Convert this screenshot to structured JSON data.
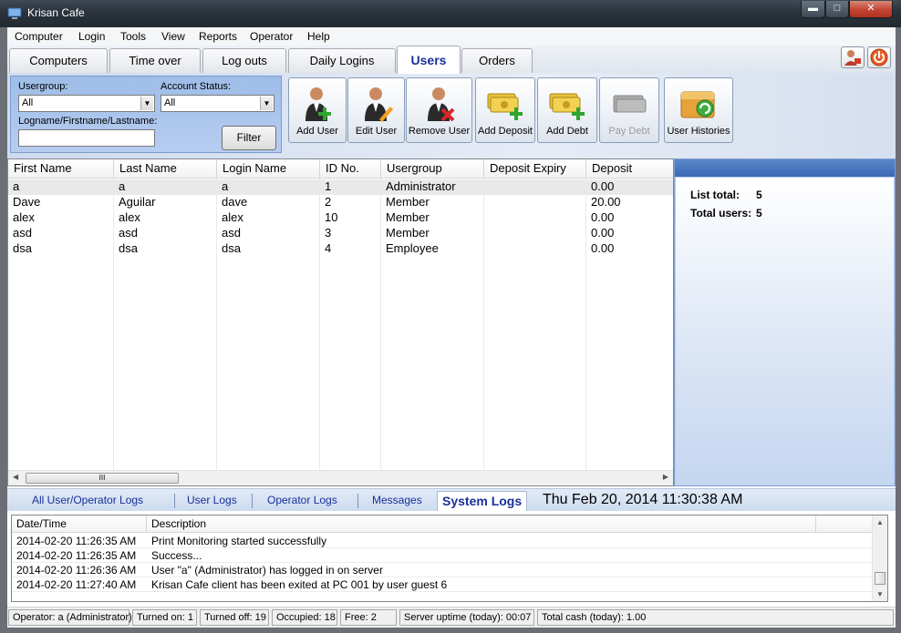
{
  "window": {
    "title": "Krisan Cafe"
  },
  "menu": [
    "Computer",
    "Login",
    "Tools",
    "View",
    "Reports",
    "Operator",
    "Help"
  ],
  "tabs": [
    {
      "label": "Computers"
    },
    {
      "label": "Time over"
    },
    {
      "label": "Log outs"
    },
    {
      "label": "Daily Logins"
    },
    {
      "label": "Users",
      "active": true
    },
    {
      "label": "Orders"
    }
  ],
  "filter": {
    "usergroup_label": "Usergroup:",
    "usergroup_value": "All",
    "account_status_label": "Account Status:",
    "account_status_value": "All",
    "name_label": "Logname/Firstname/Lastname:",
    "name_value": "",
    "filter_button": "Filter"
  },
  "toolbar": [
    {
      "label": "Add User",
      "icon": "add-user-icon",
      "enabled": true
    },
    {
      "label": "Edit User",
      "icon": "edit-user-icon",
      "enabled": true
    },
    {
      "label": "Remove User",
      "icon": "remove-user-icon",
      "enabled": true
    },
    {
      "label": "Add Deposit",
      "icon": "add-deposit-icon",
      "enabled": true
    },
    {
      "label": "Add Debt",
      "icon": "add-debt-icon",
      "enabled": true
    },
    {
      "label": "Pay Debt",
      "icon": "pay-debt-icon",
      "enabled": false
    },
    {
      "label": "User Histories",
      "icon": "user-histories-icon",
      "enabled": true
    }
  ],
  "users_table": {
    "columns": [
      "First Name",
      "Last Name",
      "Login Name",
      "ID No.",
      "Usergroup",
      "Deposit Expiry",
      "Deposit"
    ],
    "rows": [
      [
        "a",
        "a",
        "a",
        "1",
        "Administrator",
        "",
        "0.00"
      ],
      [
        "Dave",
        "Aguilar",
        "dave",
        "2",
        "Member",
        "",
        "20.00"
      ],
      [
        "alex",
        "alex",
        "alex",
        "10",
        "Member",
        "",
        "0.00"
      ],
      [
        "asd",
        "asd",
        "asd",
        "3",
        "Member",
        "",
        "0.00"
      ],
      [
        "dsa",
        "dsa",
        "dsa",
        "4",
        "Employee",
        "",
        "0.00"
      ]
    ],
    "scroll_grip": "III"
  },
  "stats": {
    "list_total_label": "List total:",
    "list_total_value": "5",
    "total_users_label": "Total users:",
    "total_users_value": "5"
  },
  "log_tabs": [
    {
      "label": "All User/Operator Logs"
    },
    {
      "label": "User Logs"
    },
    {
      "label": "Operator Logs"
    },
    {
      "label": "Messages"
    },
    {
      "label": "System Logs",
      "active": true
    }
  ],
  "clock": "Thu Feb 20, 2014  11:30:38 AM",
  "log_table": {
    "columns": [
      "Date/Time",
      "Description"
    ],
    "rows": [
      [
        "2014-02-20 11:26:35 AM",
        "Print Monitoring started successfully"
      ],
      [
        "2014-02-20 11:26:35 AM",
        "Success..."
      ],
      [
        "2014-02-20 11:26:36 AM",
        "User \"a\" (Administrator) has logged in on server"
      ],
      [
        "2014-02-20 11:27:40 AM",
        "Krisan Cafe client has been exited at PC 001 by user guest 6"
      ]
    ]
  },
  "status_bar": [
    "Operator: a (Administrator)",
    "Turned on: 1",
    "Turned off: 19",
    "Occupied: 18",
    "Free: 2",
    "Server uptime (today): 00:07",
    "Total cash (today): 1.00"
  ],
  "colors": {
    "accent": "#1a2f9a",
    "panel": "#b7cdee",
    "header_bar": "#3b69b6"
  }
}
